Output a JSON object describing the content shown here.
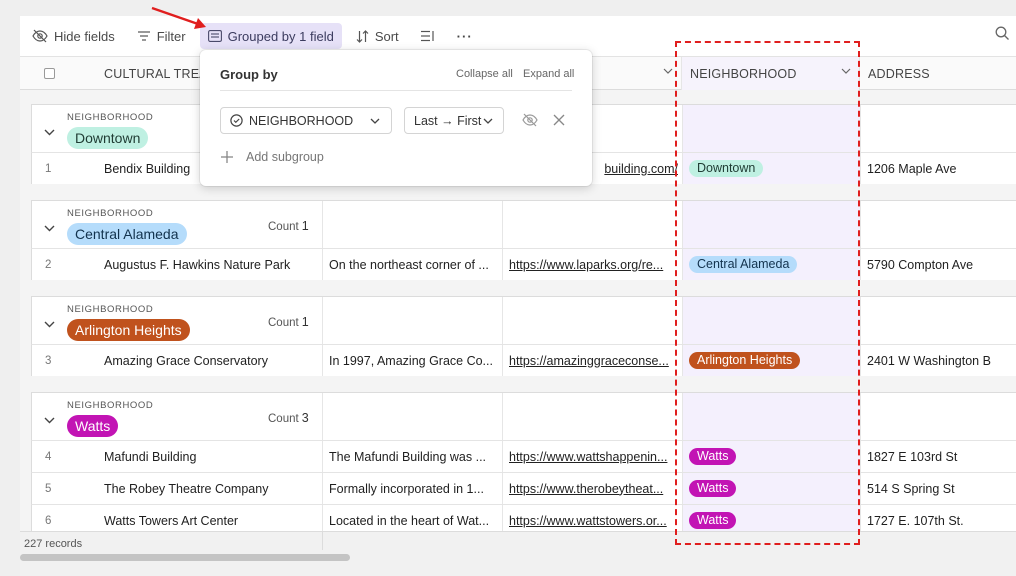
{
  "toolbar": {
    "hide_fields": "Hide fields",
    "filter": "Filter",
    "grouped": "Grouped by 1 field",
    "sort": "Sort",
    "more": "···"
  },
  "columns": {
    "primary": "CULTURAL TREAS",
    "neighborhood": "NEIGHBORHOOD",
    "address": "ADDRESS"
  },
  "groups": [
    {
      "label": "NEIGHBORHOOD",
      "name": "Downtown",
      "count_label": "Count",
      "count": ""
    },
    {
      "label": "NEIGHBORHOOD",
      "name": "Central Alameda",
      "count_label": "Count",
      "count": "1"
    },
    {
      "label": "NEIGHBORHOOD",
      "name": "Arlington Heights",
      "count_label": "Count",
      "count": "1"
    },
    {
      "label": "NEIGHBORHOOD",
      "name": "Watts",
      "count_label": "Count",
      "count": "3"
    }
  ],
  "rows": [
    {
      "num": "1",
      "name": "Bendix Building",
      "desc": "",
      "url": "building.com/",
      "neighborhood": "Downtown",
      "address": "1206 Maple Ave"
    },
    {
      "num": "2",
      "name": "Augustus F. Hawkins Nature Park",
      "desc": "On the northeast corner of ...",
      "url": "https://www.laparks.org/re...",
      "neighborhood": "Central Alameda",
      "address": "5790 Compton Ave"
    },
    {
      "num": "3",
      "name": "Amazing Grace Conservatory",
      "desc": "In 1997, Amazing Grace Co...",
      "url": "https://amazinggraceconse...",
      "neighborhood": "Arlington Heights",
      "address": "2401 W Washington B"
    },
    {
      "num": "4",
      "name": "Mafundi Building",
      "desc": "The Mafundi Building was ...",
      "url": "https://www.wattshappenin...",
      "neighborhood": "Watts",
      "address": "1827 E 103rd St"
    },
    {
      "num": "5",
      "name": "The Robey Theatre Company",
      "desc": "Formally incorporated in 1...",
      "url": "https://www.therobeytheat...",
      "neighborhood": "Watts",
      "address": "514 S Spring St"
    },
    {
      "num": "6",
      "name": "Watts Towers Art Center",
      "desc": "Located in the heart of Wat...",
      "url": "https://www.wattstowers.or...",
      "neighborhood": "Watts",
      "address": "1727 E. 107th St."
    }
  ],
  "popover": {
    "title": "Group by",
    "collapse_all": "Collapse all",
    "expand_all": "Expand all",
    "field": "NEIGHBORHOOD",
    "order": "Last → First",
    "add_subgroup": "Add subgroup"
  },
  "footer": {
    "records": "227 records"
  },
  "colors": {
    "downtown": "#bff0e2",
    "central_alameda": "#b5dcfb",
    "arlington_heights": "#c0521d",
    "watts": "#c214b4",
    "accent_active": "#e6e1f7",
    "annotation_red": "#e01e1e"
  }
}
